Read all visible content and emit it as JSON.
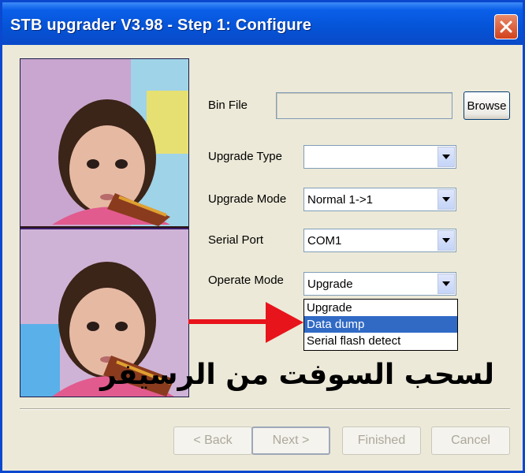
{
  "window": {
    "title": "STB upgrader V3.98 - Step 1: Configure",
    "close_icon": "close-icon"
  },
  "form": {
    "bin_file_label": "Bin File",
    "bin_file_value": "",
    "browse_label": "Browse",
    "upgrade_type_label": "Upgrade Type",
    "upgrade_type_value": "",
    "upgrade_mode_label": "Upgrade Mode",
    "upgrade_mode_value": "Normal 1->1",
    "serial_port_label": "Serial Port",
    "serial_port_value": "COM1",
    "operate_mode_label": "Operate Mode",
    "operate_mode_value": "Upgrade"
  },
  "operate_mode_options": [
    "Upgrade",
    "Data dump",
    "Serial flash detect"
  ],
  "operate_mode_highlighted": "Data dump",
  "annotation": {
    "text": "لسحب السوفت من الرسيفر",
    "arrow_color": "#e8141b"
  },
  "nav": {
    "back_label": "< Back",
    "next_label": "Next >",
    "finished_label": "Finished",
    "cancel_label": "Cancel"
  },
  "colors": {
    "titlebar": "#0553d6",
    "selection": "#316ac5",
    "dialog_bg": "#ece9d8"
  }
}
